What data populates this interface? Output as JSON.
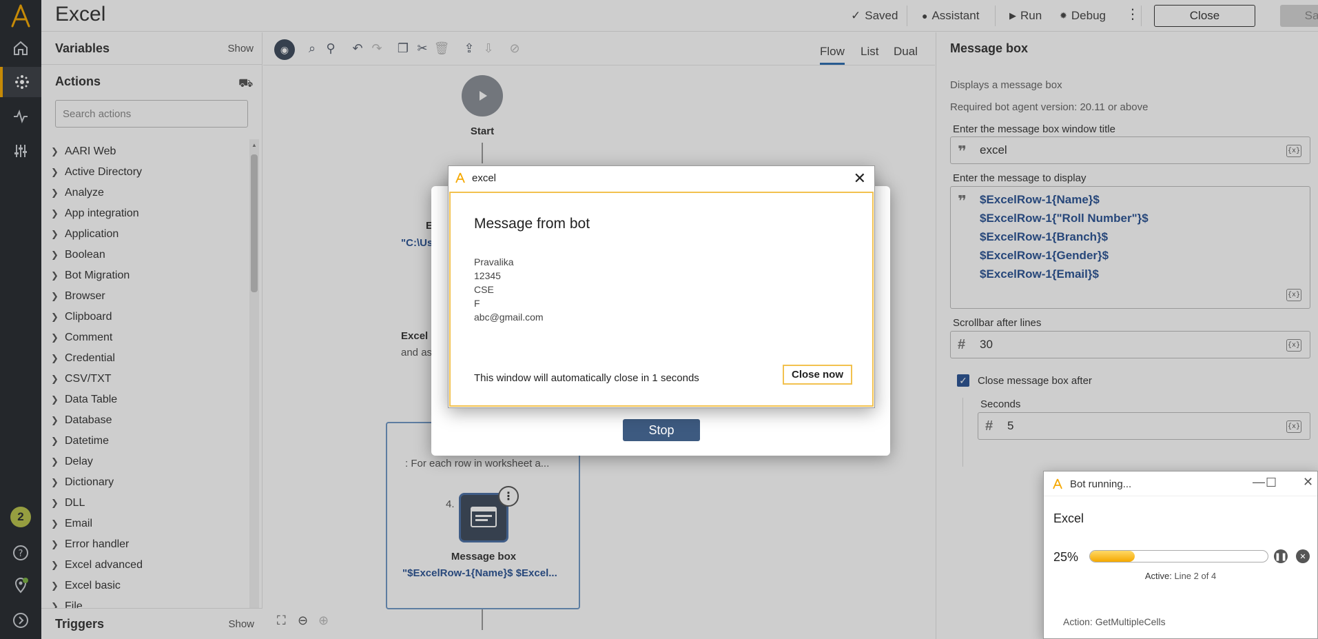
{
  "header": {
    "app_title": "Excel",
    "saved_label": "Saved",
    "assistant_label": "Assistant",
    "run_label": "Run",
    "debug_label": "Debug",
    "close_label": "Close",
    "save_label": "Save"
  },
  "palette": {
    "variables_title": "Variables",
    "variables_show": "Show",
    "actions_title": "Actions",
    "search_placeholder": "Search actions",
    "items": [
      "AARI Web",
      "Active Directory",
      "Analyze",
      "App integration",
      "Application",
      "Boolean",
      "Bot Migration",
      "Browser",
      "Clipboard",
      "Comment",
      "Credential",
      "CSV/TXT",
      "Data Table",
      "Database",
      "Datetime",
      "Delay",
      "Dictionary",
      "DLL",
      "Email",
      "Error handler",
      "Excel advanced",
      "Excel basic",
      "File"
    ],
    "triggers_title": "Triggers",
    "triggers_show": "Show"
  },
  "canvas": {
    "view_tabs": [
      "Flow",
      "List",
      "Dual"
    ],
    "start_label": "Start",
    "node2_letter": "E",
    "node2_path": "\"C:\\Us",
    "node3_title": "Excel",
    "node3_sub": "and as",
    "loop_text": ": For each row in worksheet a...",
    "node_number": "4.",
    "msgbox_label": "Message box",
    "msgbox_sub": "\"$ExcelRow-1{Name}$ $Excel..."
  },
  "props": {
    "title": "Message box",
    "description": "Displays a message box",
    "required_version": "Required bot agent version: 20.11 or above",
    "window_title_label": "Enter the message box window title",
    "window_title_value": "excel",
    "message_label": "Enter the message to display",
    "message_lines": [
      "$ExcelRow-1{Name}$",
      "$ExcelRow-1{\"Roll Number\"}$",
      "$ExcelRow-1{Branch}$",
      "$ExcelRow-1{Gender}$",
      "$ExcelRow-1{Email}$"
    ],
    "scrollbar_label": "Scrollbar after lines",
    "scrollbar_value": "30",
    "close_after_label": "Close message box after",
    "close_after_checked": true,
    "seconds_label": "Seconds",
    "seconds_value": "5",
    "var_btn": "{x}"
  },
  "run_dialog": {
    "stop_label": "Stop"
  },
  "message_window": {
    "title": "excel",
    "heading": "Message from bot",
    "lines": [
      "Pravalika",
      "12345",
      "CSE",
      "F",
      "abc@gmail.com"
    ],
    "countdown": "This window will automatically close in 1 seconds",
    "close_now": "Close now"
  },
  "bot_panel": {
    "title": "Bot running...",
    "bot_name": "Excel",
    "progress_pct": 25,
    "progress_label": "25%",
    "active_key": "Active:",
    "active_value": "Line 2 of 4",
    "action_key": "Action:",
    "action_value": "GetMultipleCells"
  },
  "rail": {
    "notification_count": "2"
  },
  "colors": {
    "accent": "#f5a800",
    "rail_bg": "#262a2f",
    "link_blue": "#2a5394",
    "stop_button": "#3d5a80"
  }
}
